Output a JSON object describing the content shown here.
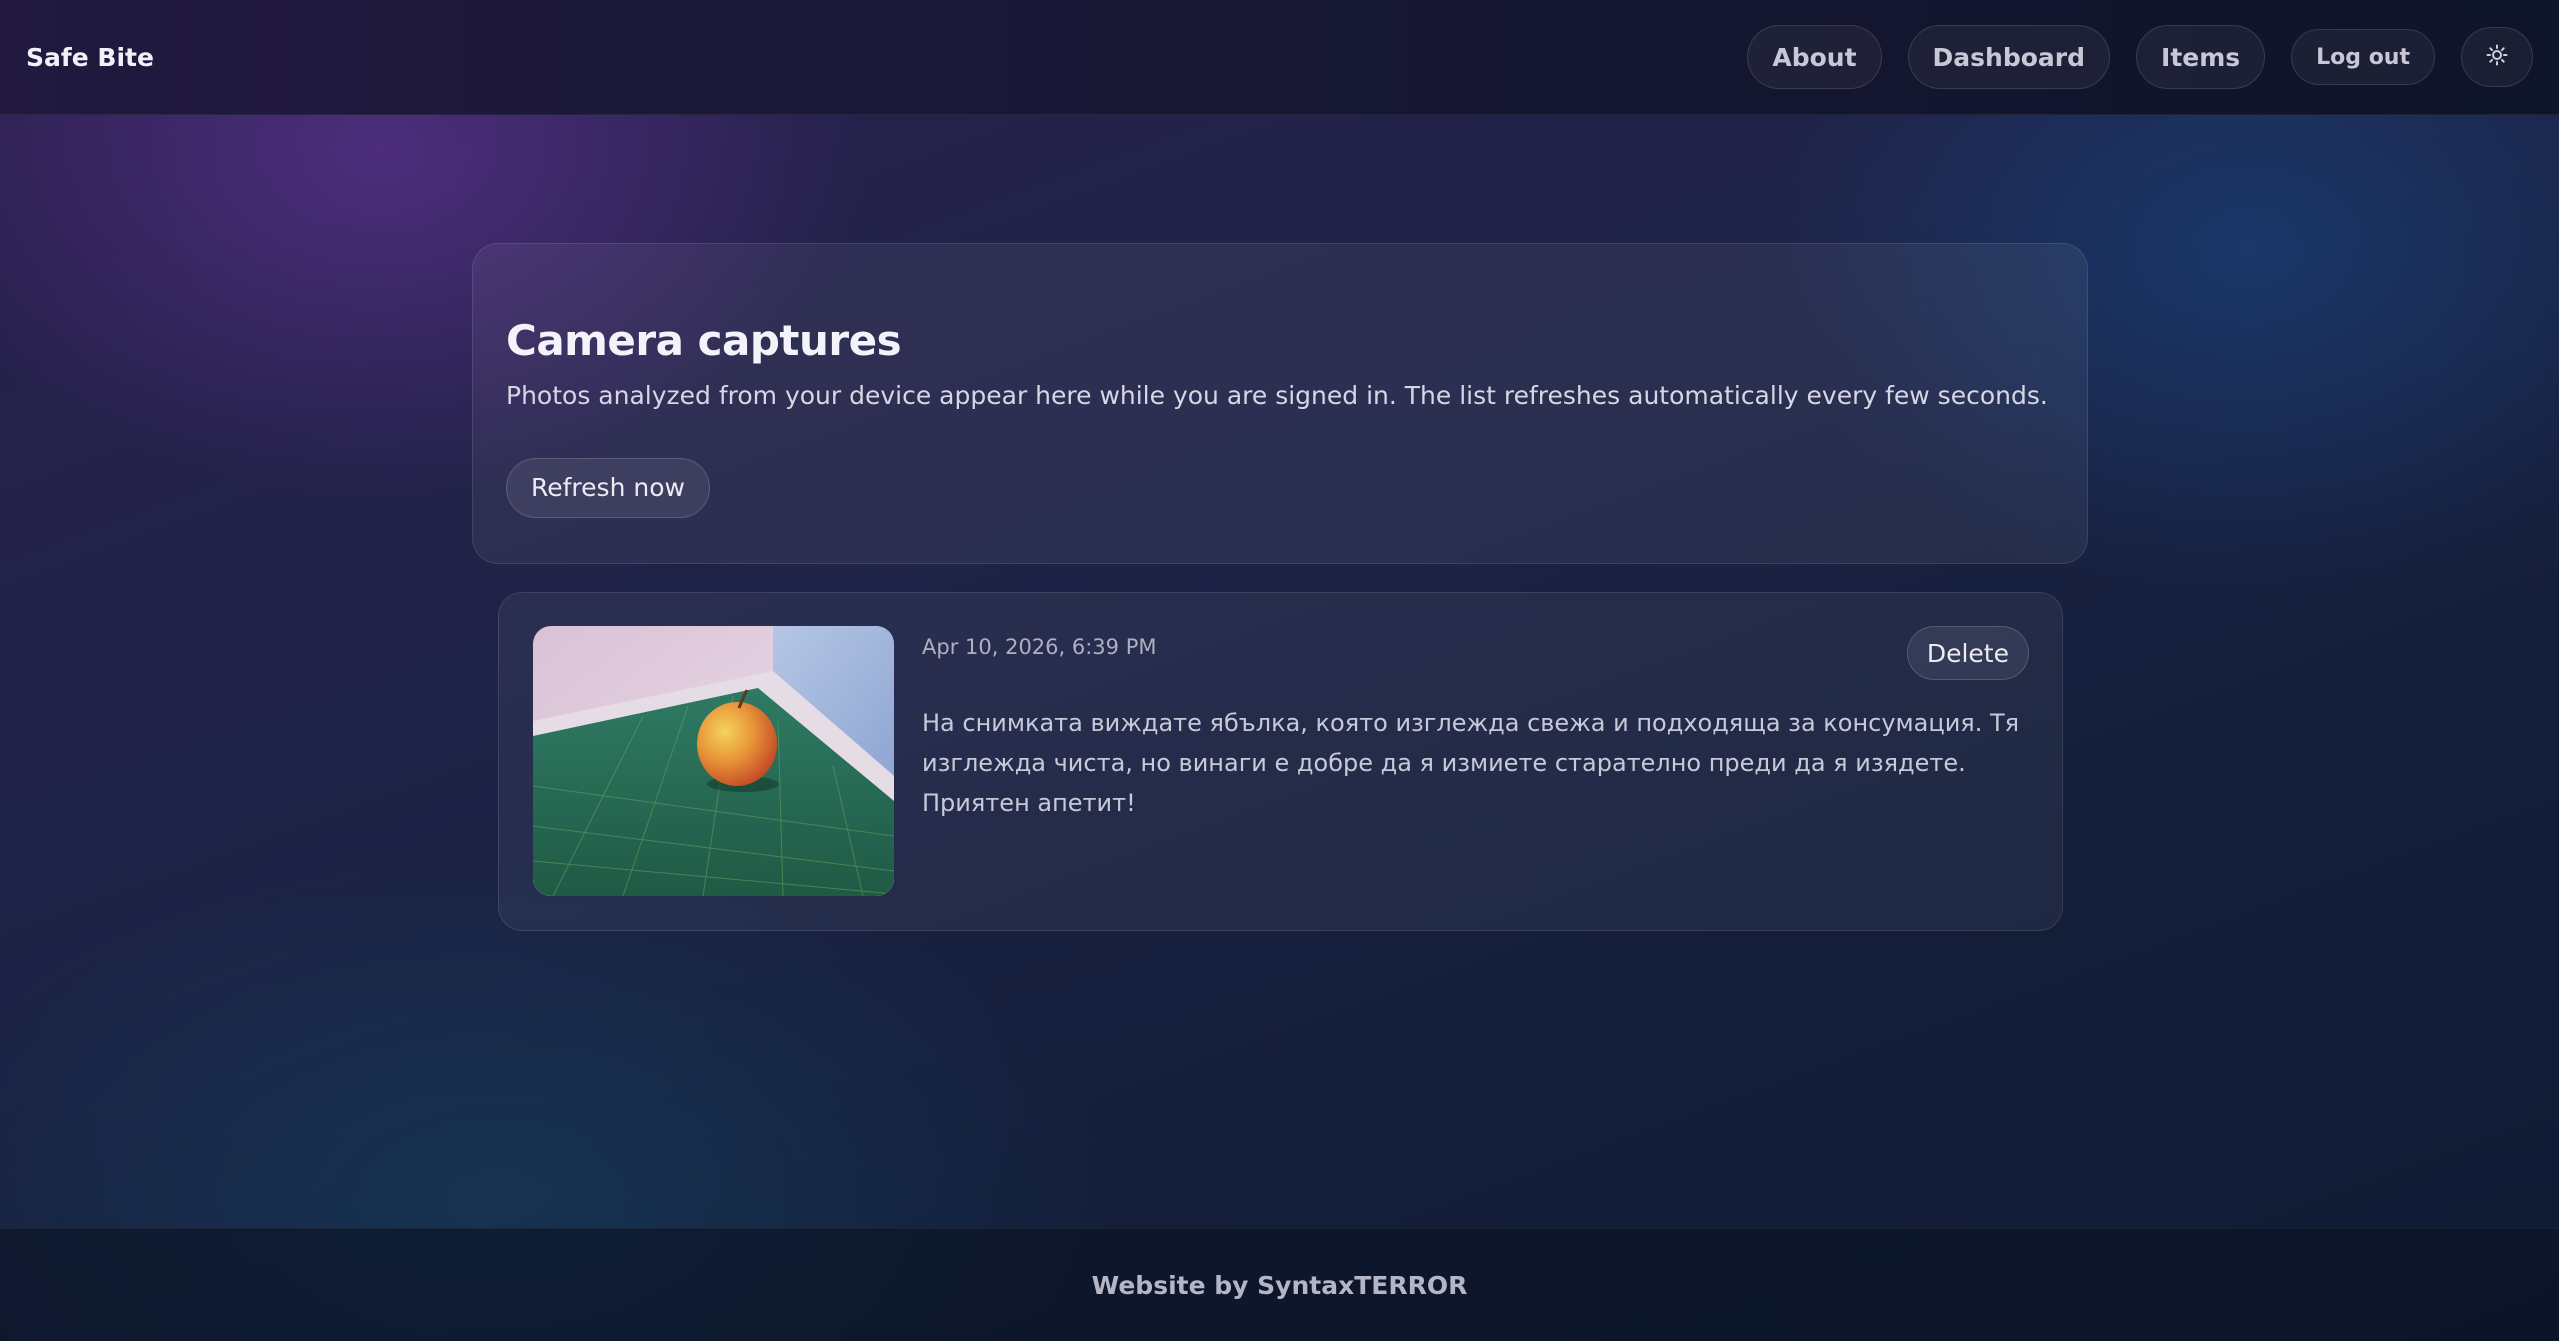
{
  "header": {
    "brand": "Safe Bite",
    "nav": {
      "about": "About",
      "dashboard": "Dashboard",
      "items": "Items",
      "logout": "Log out",
      "theme_icon": "sun-icon"
    }
  },
  "intro": {
    "title": "Camera captures",
    "description": "Photos analyzed from your device appear here while you are signed in. The list refreshes automatically every few seconds.",
    "refresh_label": "Refresh now"
  },
  "captures": [
    {
      "timestamp": "Apr 10, 2026, 6:39 PM",
      "delete_label": "Delete",
      "image_subject": "apple on green cutting mat",
      "description": "На снимката виждате ябълка, която изглежда свежа и подходяща за консумация. Тя изглежда чиста, но винаги е добре да я измиете старателно преди да я изядете. Приятен апетит!"
    }
  ],
  "footer": {
    "text": "Website by SyntaxTERROR"
  }
}
